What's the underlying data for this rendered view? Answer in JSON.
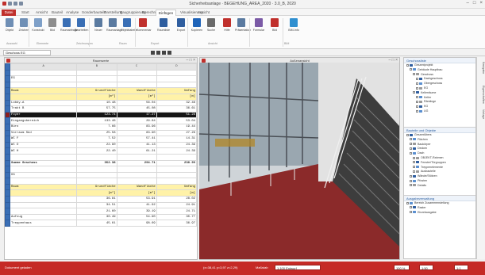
{
  "window": {
    "title": "Sicherheitsanlage · BEGEHUNG_AREA_2020 · 3.0_B, 2020"
  },
  "menu": [
    "Datei",
    "Start",
    "Ansicht",
    "Bauteil",
    "Analyse",
    "Sonderbauteile",
    "Darstellung",
    "Baugruppierung",
    "Berechnung",
    "Einfügen",
    "Visualisierung",
    "Ansicht"
  ],
  "ribbon": {
    "buttons": [
      "Objekt",
      "Zeichen",
      "Konstrukt",
      "Bild",
      "Raumabfrage",
      "Bearbeiten",
      "Neuer",
      "Raumanlage",
      "Objekttabelle",
      "Kommentar",
      "Raumliste",
      "Export",
      "Kopieren",
      "Suche",
      "Hilfe",
      "Präsentation",
      "Formular",
      "Bild",
      "BIM-Info"
    ],
    "groups": [
      "Auswahl",
      "Elemente",
      "Zeichnungen",
      "Raum",
      "Export",
      "Ansicht",
      "BIM"
    ]
  },
  "toolrow": {
    "combo": "Geschoss EG"
  },
  "spreadsheet": {
    "title": "Raumwerte",
    "cols": [
      "A",
      "B",
      "C",
      "D"
    ],
    "rows": [
      [
        "",
        "",
        "",
        ""
      ],
      [
        "EG",
        "",
        "",
        ""
      ],
      [
        "",
        "",
        "",
        ""
      ],
      [
        "Raum",
        "Grundfläche",
        "Wandfläche",
        "Umfang"
      ],
      [
        "",
        "[m²]",
        "[m²]",
        "[m]"
      ],
      [
        "Lobby-A",
        "10.48",
        "56.04",
        "32.48"
      ],
      [
        "Trakt B",
        "57.75",
        "45.08",
        "36.61"
      ],
      [
        "Foyer",
        "123.74",
        "17.27",
        "51.28"
      ],
      [
        "Eingangsbereich",
        "133.46",
        "29.84",
        "53.04"
      ],
      [
        "Büro",
        "7.66",
        "83.96",
        "19.44"
      ],
      [
        "Vorraum Süd",
        "25.58",
        "83.90",
        "27.26"
      ],
      [
        "WC F",
        "7.52",
        "57.41",
        "14.31"
      ],
      [
        "WC D",
        "22.90",
        "41.13",
        "24.39"
      ],
      [
        "WC H",
        "22.40",
        "61.21",
        "24.39"
      ],
      [
        "",
        "",
        "",
        ""
      ],
      [
        "Summe Geschoss",
        "352.38",
        "294.71",
        "238.99"
      ],
      [
        "",
        "",
        "",
        ""
      ],
      [
        "OG",
        "",
        "",
        ""
      ],
      [
        "",
        "",
        "",
        ""
      ],
      [
        "Raum",
        "Grundfläche",
        "Wandfläche",
        "Umfang"
      ],
      [
        "",
        "[m²]",
        "[m²]",
        "[m]"
      ],
      [
        "",
        "36.81",
        "53.91",
        "28.02"
      ],
      [
        "",
        "34.51",
        "41.92",
        "24.91"
      ],
      [
        "",
        "21.60",
        "39.19",
        "24.71"
      ],
      [
        "Aufzug",
        "30.49",
        "54.90",
        "30.77"
      ],
      [
        "Treppenhaus",
        "45.61",
        "98.69",
        "36.97"
      ]
    ]
  },
  "view3d": {
    "title": "Außenansicht"
  },
  "sidebar": {
    "panel1": {
      "title": "Geschossliste",
      "items": [
        "Gesamtprojekt",
        "Gebäude Hauptbau",
        "Geschoss",
        "Dachgeschoss",
        "Obergeschoss",
        "EG",
        "Kellerräume",
        "Keller",
        "Rämlinge",
        "KG",
        "UG"
      ]
    },
    "panel2": {
      "title": "Bauteile und Objekte",
      "items": [
        "Gesamtübers",
        "Flächen",
        "Baukörper",
        "Decken",
        "Dach",
        "OBJEKT-Rahmen",
        "Fenster/Türgruppen",
        "Treppenelemente",
        "Ausbauteile",
        "Wände/Stützen",
        "Pfosten",
        "Details"
      ]
    },
    "panel3": {
      "title": "Ausgabeverwaltung",
      "items": [
        "Bereich Zusammenstellung",
        "Raster",
        "Einzelausgabe"
      ]
    },
    "tabs": [
      "Navigator",
      "Eigenschaften",
      "Vorlage"
    ]
  },
  "status": {
    "left": "Dokument geladen",
    "coords": "(x=38,41 y=3,97 z=2,29)",
    "mid": "Maßstab",
    "scale": "1:100 Entwurf",
    "zoom": "100 %",
    "r1": "1:50",
    "r2": "1:1"
  },
  "colors": {
    "accent": "#c52a26",
    "floor": "#8b2a2a",
    "highlight": "#fff2a8"
  }
}
